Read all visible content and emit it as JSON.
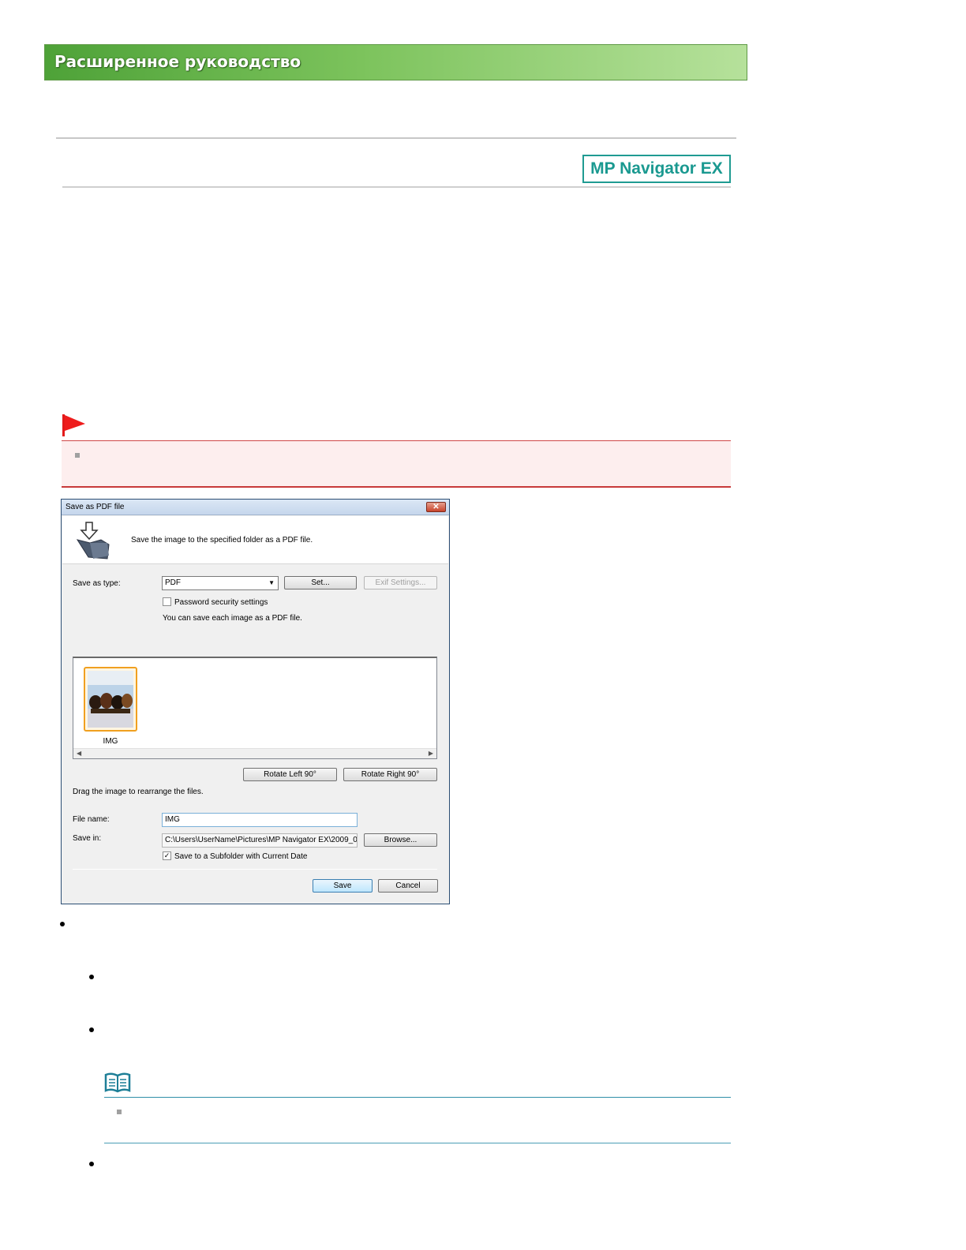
{
  "banner": {
    "title": "Расширенное руководство"
  },
  "logo": {
    "text": "MP Navigator EX"
  },
  "dialog": {
    "title": "Save as PDF file",
    "description": "Save the image to the specified folder as a PDF file.",
    "save_as_type_label": "Save as  type:",
    "save_as_type_value": "PDF",
    "set_button": "Set...",
    "exif_button": "Exif Settings...",
    "password_checkbox": {
      "label": "Password security settings",
      "checked": false
    },
    "info_text": "You can save each image as a PDF file.",
    "thumbnail_label": "IMG",
    "rotate_left_button": "Rotate Left 90°",
    "rotate_right_button": "Rotate Right 90°",
    "drag_hint": "Drag the image to rearrange the files.",
    "file_name_label": "File name:",
    "file_name_value": "IMG",
    "save_in_label": "Save in:",
    "save_in_value": "C:\\Users\\UserName\\Pictures\\MP Navigator EX\\2009_0",
    "browse_button": "Browse...",
    "subfolder_checkbox": {
      "label": "Save to a Subfolder with Current Date",
      "checked": true
    },
    "save_button": "Save",
    "cancel_button": "Cancel"
  },
  "colors": {
    "banner_green": "#4ea238",
    "logo_teal": "#1a9990",
    "important_red": "#c73a3a",
    "note_teal": "#2f8fa8"
  }
}
